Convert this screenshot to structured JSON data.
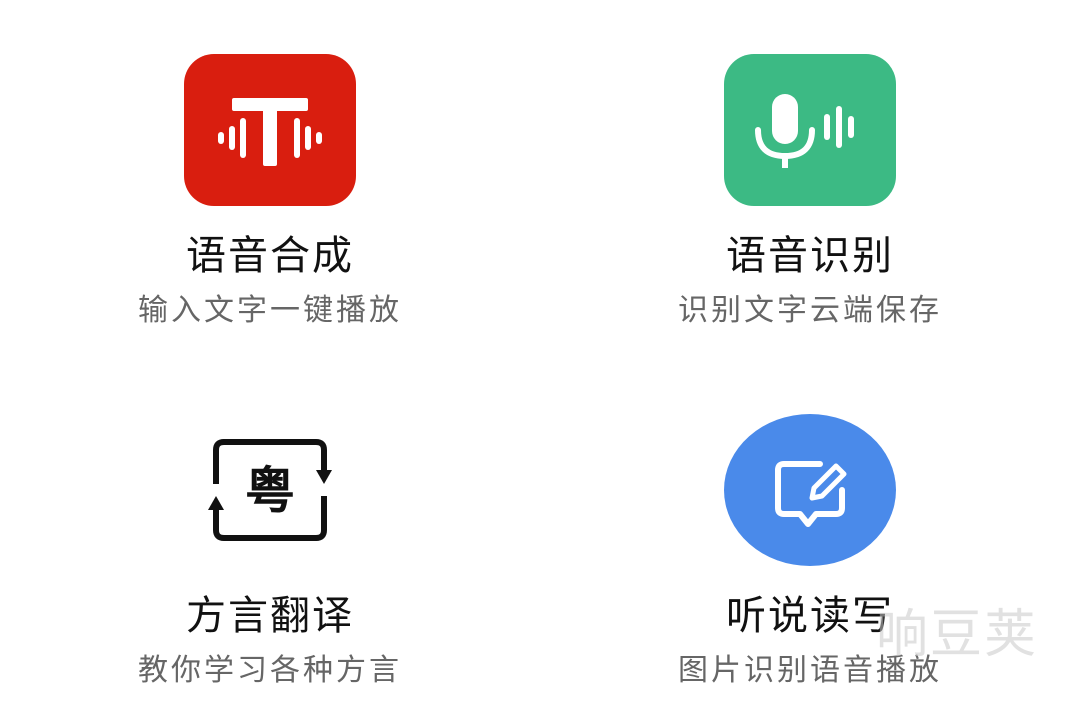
{
  "colors": {
    "tts": "#d91e0f",
    "asr": "#3cba84",
    "dialect": "#111111",
    "write": "#4a8aea",
    "title": "#111111",
    "subtitle": "#666666"
  },
  "features": [
    {
      "title": "语音合成",
      "subtitle": "输入文字一键播放",
      "icon": "text-to-speech-icon"
    },
    {
      "title": "语音识别",
      "subtitle": "识别文字云端保存",
      "icon": "microphone-waveform-icon"
    },
    {
      "title": "方言翻译",
      "subtitle": "教你学习各种方言",
      "icon": "cantonese-dialect-icon",
      "icon_text": "粤"
    },
    {
      "title": "听说读写",
      "subtitle": "图片识别语音播放",
      "icon": "edit-message-icon"
    }
  ],
  "watermark": "响豆荚"
}
